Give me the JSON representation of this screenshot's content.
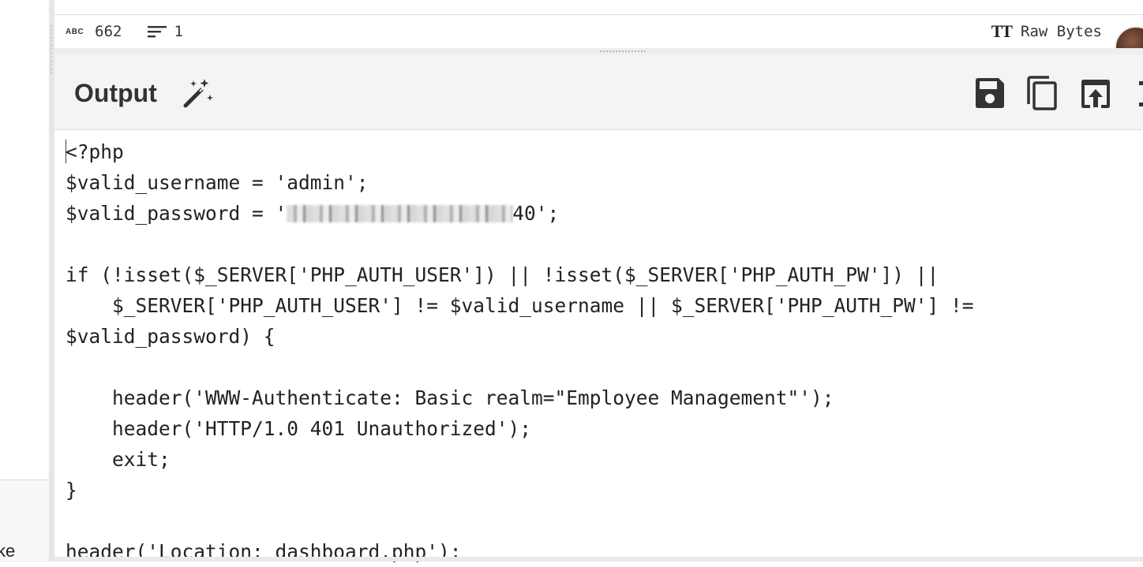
{
  "left_pane": {
    "cut_text": "ke"
  },
  "status": {
    "abc_label": "ABC",
    "char_count": "662",
    "line_count": "1",
    "format_label": "Raw Bytes"
  },
  "output": {
    "title": "Output",
    "code_lines": {
      "l1": "<?php",
      "l2": "$valid_username = 'admin';",
      "l3_prefix": "$valid_password = '",
      "l3_suffix": "40';",
      "l4": "",
      "l5": "if (!isset($_SERVER['PHP_AUTH_USER']) || !isset($_SERVER['PHP_AUTH_PW']) ||",
      "l6": "    $_SERVER['PHP_AUTH_USER'] != $valid_username || $_SERVER['PHP_AUTH_PW'] !=",
      "l7": "$valid_password) {",
      "l8": "",
      "l9": "    header('WWW-Authenticate: Basic realm=\"Employee Management\"');",
      "l10": "    header('HTTP/1.0 401 Unauthorized');",
      "l11": "    exit;",
      "l12": "}",
      "l13": "",
      "l14": "header('Location: dashboard.php');"
    }
  },
  "icons": {
    "abc": "abc-icon",
    "lines": "lines-icon",
    "text_format": "text-format-icon",
    "magic": "magic-wand-icon",
    "save": "save-icon",
    "copy": "copy-icon",
    "replace_input": "open-in-input-icon",
    "maximise": "maximise-icon"
  }
}
